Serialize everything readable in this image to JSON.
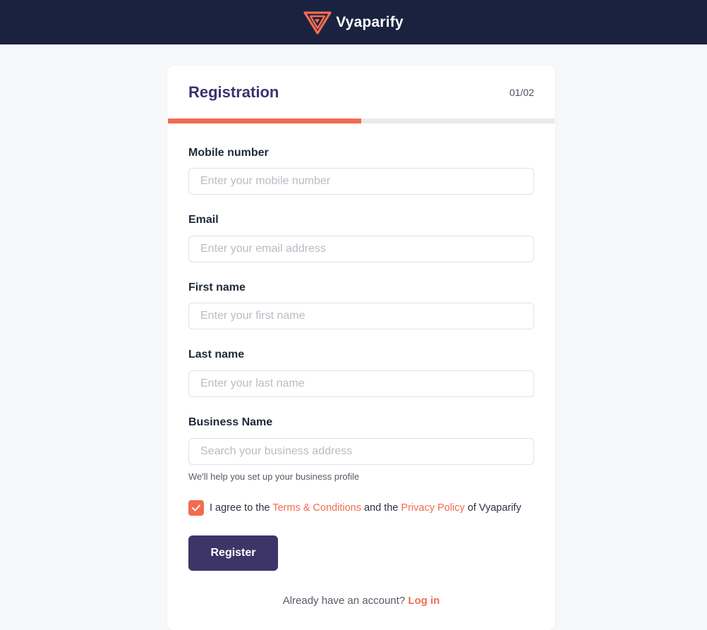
{
  "header": {
    "logo_icon": "vyaparify-triangle-logo",
    "brand_name": "Vyaparify",
    "bg_color": "#1a2240"
  },
  "card": {
    "title": "Registration",
    "step": "01/02",
    "progress_fraction": 0.5
  },
  "form": {
    "fields": [
      {
        "label": "Mobile number",
        "placeholder": "Enter your mobile number",
        "value": ""
      },
      {
        "label": "Email",
        "placeholder": "Enter your email address",
        "value": ""
      },
      {
        "label": "First name",
        "placeholder": "Enter your first name",
        "value": ""
      },
      {
        "label": "Last name",
        "placeholder": "Enter your last name",
        "value": ""
      },
      {
        "label": "Business Name",
        "placeholder": "Search your business address",
        "value": ""
      }
    ],
    "business_hint": "We'll help you set up your business profile",
    "agree": {
      "checked": true,
      "prefix": "I agree to the",
      "terms_link": "Terms & Conditions",
      "middle": "and the",
      "privacy_link": "Privacy Policy",
      "suffix": "of Vyaparify",
      "check_icon": "check-icon"
    },
    "register_label": "Register"
  },
  "footer": {
    "prompt": "Already have an account?",
    "login_link": "Log in"
  },
  "colors": {
    "accent": "#f26c4f",
    "primary_button": "#3d3568",
    "title": "#3a3370"
  }
}
